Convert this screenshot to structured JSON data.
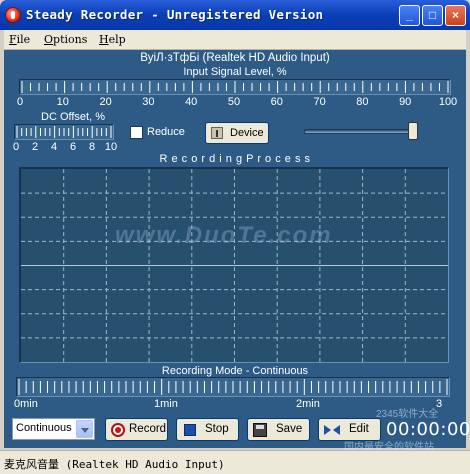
{
  "window": {
    "title": "Steady Recorder - Unregistered Version",
    "minimize_glyph": "_",
    "maximize_glyph": "□",
    "close_glyph": "×"
  },
  "menu": {
    "file": {
      "first": "F",
      "rest": "ile"
    },
    "options": {
      "first": "O",
      "rest": "ptions"
    },
    "help": {
      "first": "H",
      "rest": "elp"
    }
  },
  "device_header": "ВуіЛ·зТфБі (Realtek HD Audio Input)",
  "input_level": {
    "label": "Input Signal Level, %",
    "ticks": [
      "0",
      "10",
      "20",
      "30",
      "40",
      "50",
      "60",
      "70",
      "80",
      "90",
      "100"
    ]
  },
  "dc_offset": {
    "label": "DC Offset, %",
    "ticks": [
      "0",
      "2",
      "4",
      "6",
      "8",
      "10"
    ]
  },
  "reduce_label": "Reduce",
  "reduce_checked": false,
  "device_button": "Device",
  "volume_slider_value": 1.0,
  "recording_process_label": "R e c o r d i n g   P r o c e s s",
  "watermark": "www.DuoTe.com",
  "recording_mode": {
    "label": "Recording Mode - Continuous",
    "ticks": [
      "0min",
      "1min",
      "2min",
      "3"
    ]
  },
  "mode_select": {
    "value": "Continuous"
  },
  "buttons": {
    "record": "Record",
    "stop": "Stop",
    "save": "Save",
    "edit": "Edit"
  },
  "timer": "00:00:00",
  "corner_watermark": {
    "top": "2345软件大全",
    "bottom": "国内最安全的软件站"
  },
  "status_text": "麦克风音量 (Realtek HD Audio Input)",
  "colors": {
    "panel": "#2d5b86",
    "title_bar": "#0a3fb8"
  }
}
